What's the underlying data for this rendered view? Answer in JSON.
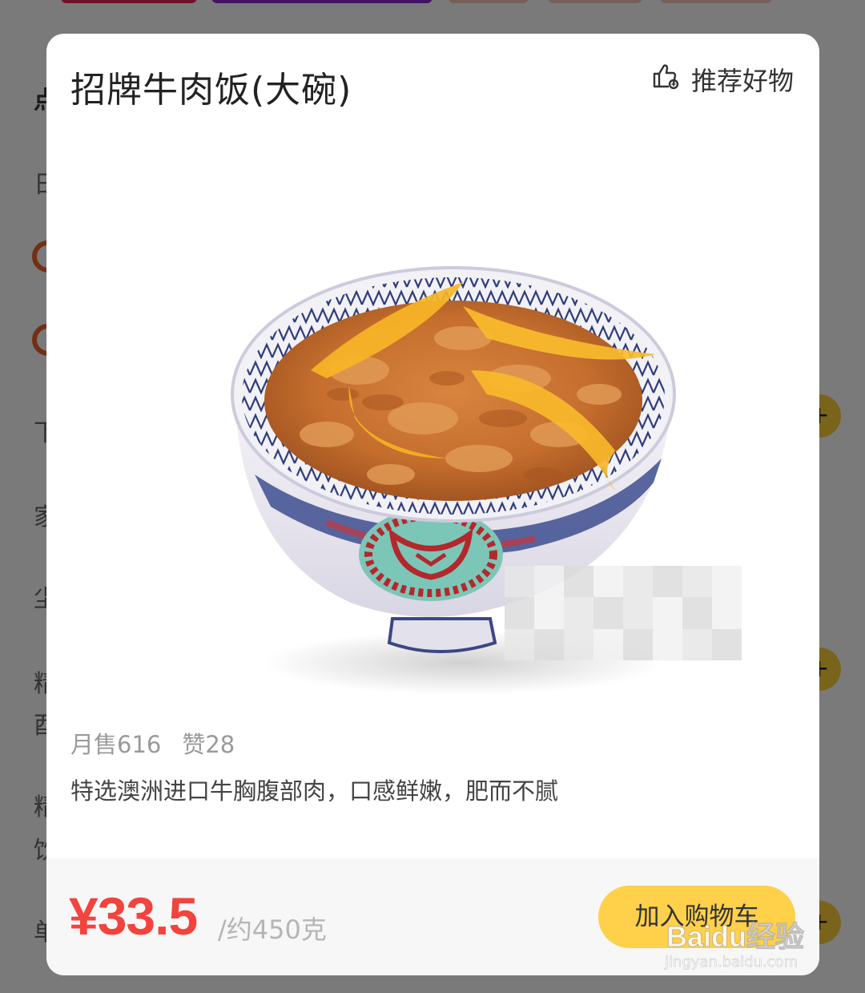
{
  "background": {
    "sidebar_glyphs": [
      "点",
      "日",
      "下",
      "家",
      "尘",
      "精",
      "酉",
      "精",
      "饮",
      "单"
    ]
  },
  "modal": {
    "title": "招牌牛肉饭(大碗)",
    "recommend_label": "推荐好物",
    "monthly_sales": "月售616",
    "likes": "赞28",
    "description": "特选澳洲进口牛胸腹部肉，口感鲜嫩，肥而不腻",
    "price": "¥33.5",
    "unit": "/约450克",
    "add_to_cart_label": "加入购物车"
  },
  "watermark": {
    "logo": "Baidu经验",
    "url": "jingyan.baidu.com"
  },
  "colors": {
    "price": "#f2433d",
    "cart_button": "#ffd04a",
    "overlay": "rgba(0,0,0,0.52)"
  }
}
